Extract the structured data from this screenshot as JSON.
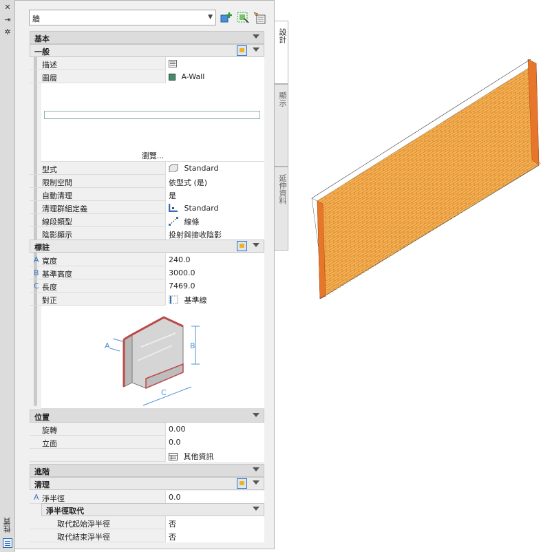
{
  "left_strip": {
    "title": "性質",
    "close_icon": "close-icon",
    "autohide_icon": "autohide-icon",
    "settings_icon": "gear-icon"
  },
  "selector": {
    "value": "牆",
    "tool_icons": [
      "add-selected-icon",
      "quick-select-icon",
      "select-objects-icon"
    ]
  },
  "tabs": [
    "設計",
    "顯示",
    "延伸資料"
  ],
  "sections": {
    "basic": "基本",
    "general": "一般",
    "annotation": "標註",
    "location": "位置",
    "advanced": "進階",
    "cleanup": "清理",
    "radius_override": "淨半徑取代"
  },
  "general_rows": [
    {
      "label": "描述",
      "value": "",
      "icon": "description-icon"
    },
    {
      "label": "圖層",
      "value": "A-Wall",
      "icon": "layer-color-swatch"
    }
  ],
  "browse_label": "瀏覽...",
  "style_rows": [
    {
      "label": "型式",
      "value": "Standard",
      "icon": "style-icon"
    },
    {
      "label": "限制空間",
      "value": "依型式 (是)"
    },
    {
      "label": "自動清理",
      "value": "是"
    },
    {
      "label": "清理群組定義",
      "value": "Standard",
      "icon": "cleanup-group-icon"
    },
    {
      "label": "線段類型",
      "value": "線條",
      "icon": "segment-line-icon"
    },
    {
      "label": "陰影顯示",
      "value": "投射與接收陰影"
    }
  ],
  "dimension_rows": [
    {
      "mark": "A",
      "label": "寬度",
      "value": "240.0"
    },
    {
      "mark": "B",
      "label": "基準高度",
      "value": "3000.0"
    },
    {
      "mark": "C",
      "label": "長度",
      "value": "7469.0"
    },
    {
      "mark": "",
      "label": "對正",
      "value": "基準線",
      "icon": "justify-icon"
    }
  ],
  "diagram_labels": {
    "a": "A",
    "b": "B",
    "c": "C"
  },
  "location_rows": [
    {
      "label": "旋轉",
      "value": "0.00"
    },
    {
      "label": "立面",
      "value": "0.0"
    },
    {
      "label": "",
      "value": "其他資訊",
      "icon": "info-table-icon"
    }
  ],
  "cleanup_rows": [
    {
      "mark": "A",
      "label": "淨半徑",
      "value": "0.0"
    }
  ],
  "override_rows": [
    {
      "label": "取代起始淨半徑",
      "value": "否"
    },
    {
      "label": "取代結束淨半徑",
      "value": "否"
    }
  ],
  "colors": {
    "accent": "#2f6fb6",
    "layer_swatch": "#3e8f69",
    "brick": "#f0a040",
    "brick_mortar": "#d9741e",
    "wall_cap": "#b94a48"
  }
}
